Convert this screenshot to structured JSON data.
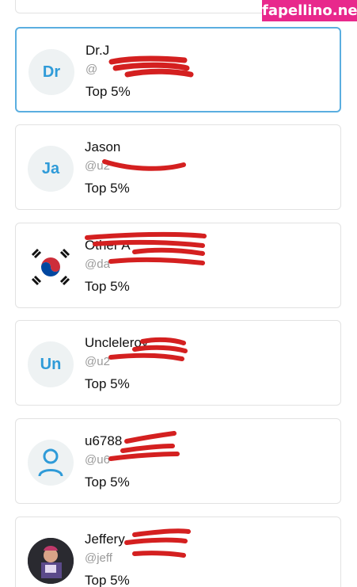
{
  "watermark": "fapellino.net",
  "colors": {
    "accent": "#2f9bd8",
    "selected_border": "#5aaee0",
    "redaction": "#d42020"
  },
  "users": [
    {
      "initials": "Dr",
      "name": "Dr.J",
      "handle": "@",
      "rank": "Top 5%",
      "avatar_type": "initials",
      "selected": true
    },
    {
      "initials": "Ja",
      "name": "Jason",
      "handle": "@u2",
      "rank": "Top 5%",
      "avatar_type": "initials",
      "selected": false
    },
    {
      "initials": "",
      "name": "Other A",
      "handle": "@da",
      "rank": "Top 5%",
      "avatar_type": "korean-flag",
      "selected": false
    },
    {
      "initials": "Un",
      "name": "Uncleleroy",
      "handle": "@u2",
      "rank": "Top 5%",
      "avatar_type": "initials",
      "selected": false
    },
    {
      "initials": "",
      "name": "u6788",
      "handle": "@u6",
      "rank": "Top 5%",
      "avatar_type": "person-icon",
      "selected": false
    },
    {
      "initials": "",
      "name": "Jeffery",
      "handle": "@jeff",
      "rank": "Top 5%",
      "avatar_type": "photo",
      "selected": false
    }
  ]
}
